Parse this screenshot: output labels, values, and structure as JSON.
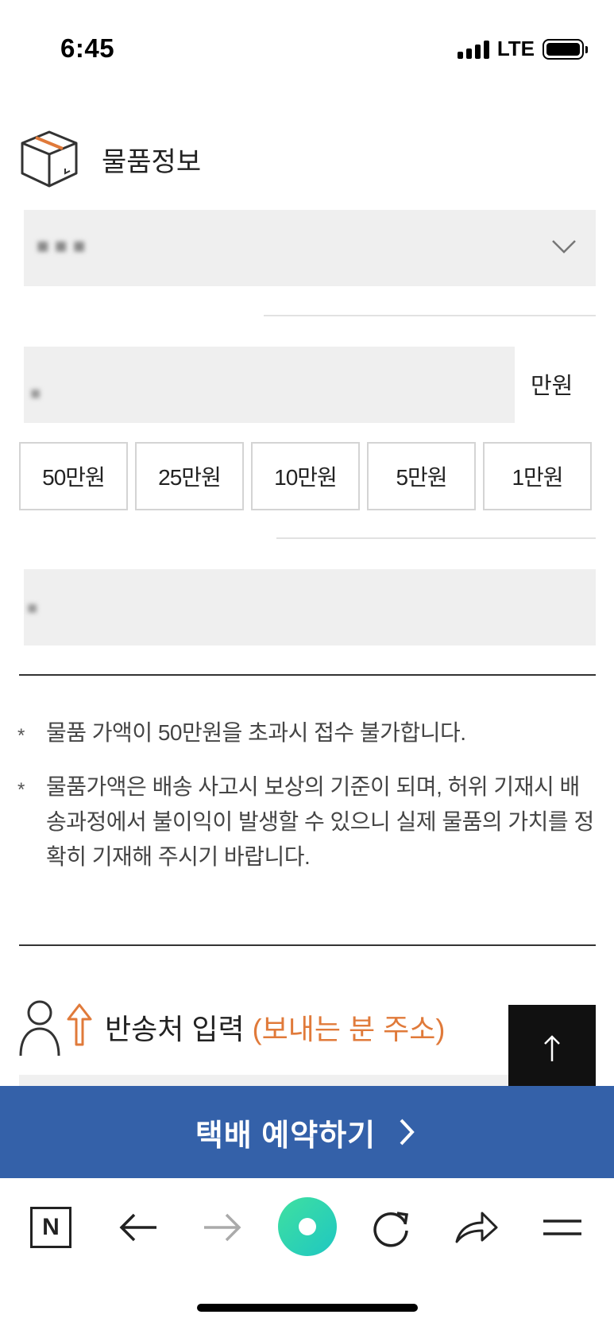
{
  "status_bar": {
    "time": "6:45",
    "network": "LTE"
  },
  "item_info": {
    "title": "물품정보",
    "select_value": "■ ■ ■",
    "amount_placeholder": "■",
    "amount_unit": "만원",
    "quick_amounts": [
      "50만원",
      "25만원",
      "10만원",
      "5만원",
      "1만원"
    ],
    "name_placeholder": "■"
  },
  "notices": [
    "물품 가액이 50만원을 초과시 접수 불가합니다.",
    "물품가액은 배송 사고시 보상의 기준이 되며, 허위 기재시 배송과정에서 불이익이 발생할 수 있으니 실제 물품의 가치를 정확히 기재해 주시기 바랍니다."
  ],
  "notice_bullet": "*",
  "return_address": {
    "title": "반송처 입력",
    "subtitle": "(보내는 분 주소)"
  },
  "reserve_button": {
    "label": "택배 예약하기"
  },
  "browser_toolbar": {
    "home_label": "N"
  },
  "colors": {
    "accent_orange": "#e07a3a",
    "reserve_blue": "#3461a9"
  }
}
